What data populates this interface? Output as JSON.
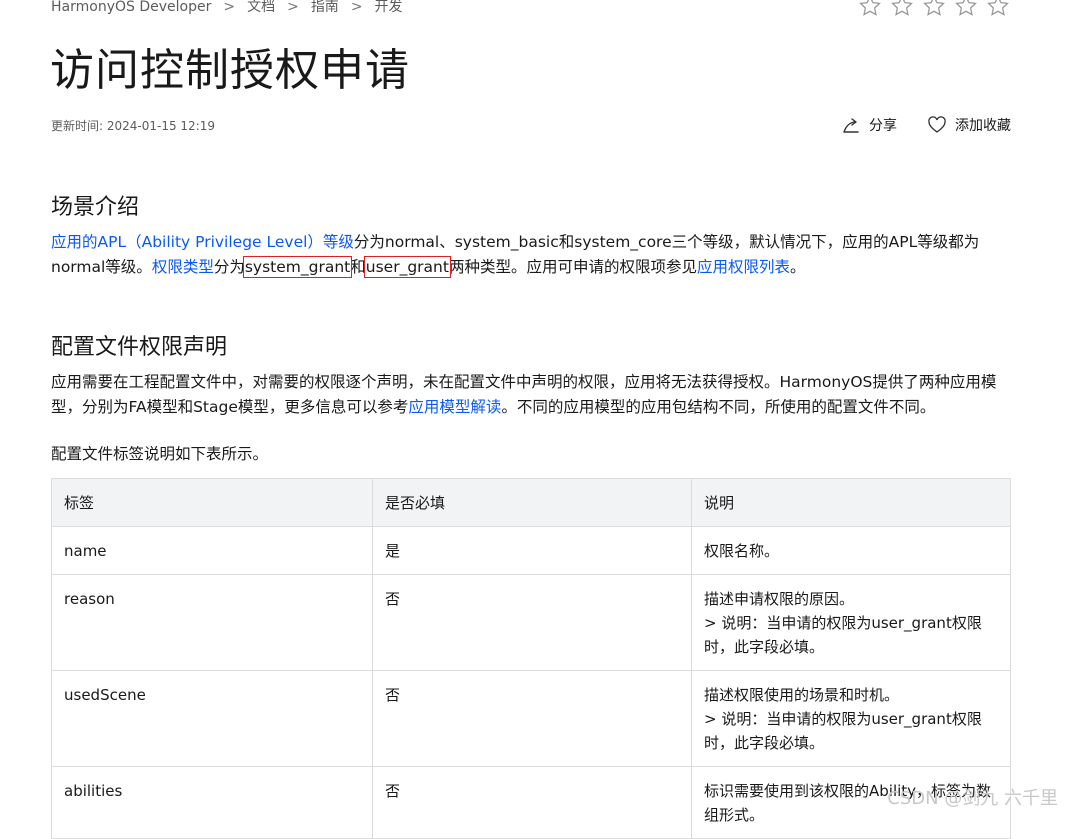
{
  "breadcrumb": [
    "HarmonyOS Developer",
    "文档",
    "指南",
    "开发"
  ],
  "rating": {
    "stars": 5,
    "filled": 0
  },
  "page_title": "访问控制授权申请",
  "update_time": "更新时间: 2024-01-15 12:19",
  "actions": {
    "share": "分享",
    "favorite": "添加收藏"
  },
  "section1": {
    "heading": "场景介绍",
    "link_apl": "应用的APL（Ability Privilege Level）等级",
    "text_a": "分为normal、system_basic和system_core三个等级，默认情况下，应用的APL等级都为normal等级。",
    "link_type": "权限类型",
    "text_b": "分为",
    "grant_system": "system_grant",
    "text_c": "和",
    "grant_user": "user_grant",
    "text_d": "两种类型。应用可申请的权限项参见",
    "link_list": "应用权限列表",
    "text_e": "。"
  },
  "section2": {
    "heading": "配置文件权限声明",
    "text_a": "应用需要在工程配置文件中，对需要的权限逐个声明，未在配置文件中声明的权限，应用将无法获得授权。HarmonyOS提供了两种应用模型，分别为FA模型和Stage模型，更多信息可以参考",
    "link_model": "应用模型解读",
    "text_b": "。不同的应用模型的应用包结构不同，所使用的配置文件不同。",
    "table_intro": "配置文件标签说明如下表所示。"
  },
  "table": {
    "headers": [
      "标签",
      "是否必填",
      "说明"
    ],
    "rows": [
      {
        "tag": "name",
        "required": "是",
        "desc": "权限名称。",
        "note": ""
      },
      {
        "tag": "reason",
        "required": "否",
        "desc": "描述申请权限的原因。",
        "note": "> 说明：当申请的权限为user_grant权限时，此字段必填。"
      },
      {
        "tag": "usedScene",
        "required": "否",
        "desc": "描述权限使用的场景和时机。",
        "note": "> 说明：当申请的权限为user_grant权限时，此字段必填。"
      },
      {
        "tag": "abilities",
        "required": "否",
        "desc": "标识需要使用到该权限的Ability，标签为数组形式。",
        "note": ""
      }
    ]
  },
  "watermark": "CSDN @剑九 六千里"
}
